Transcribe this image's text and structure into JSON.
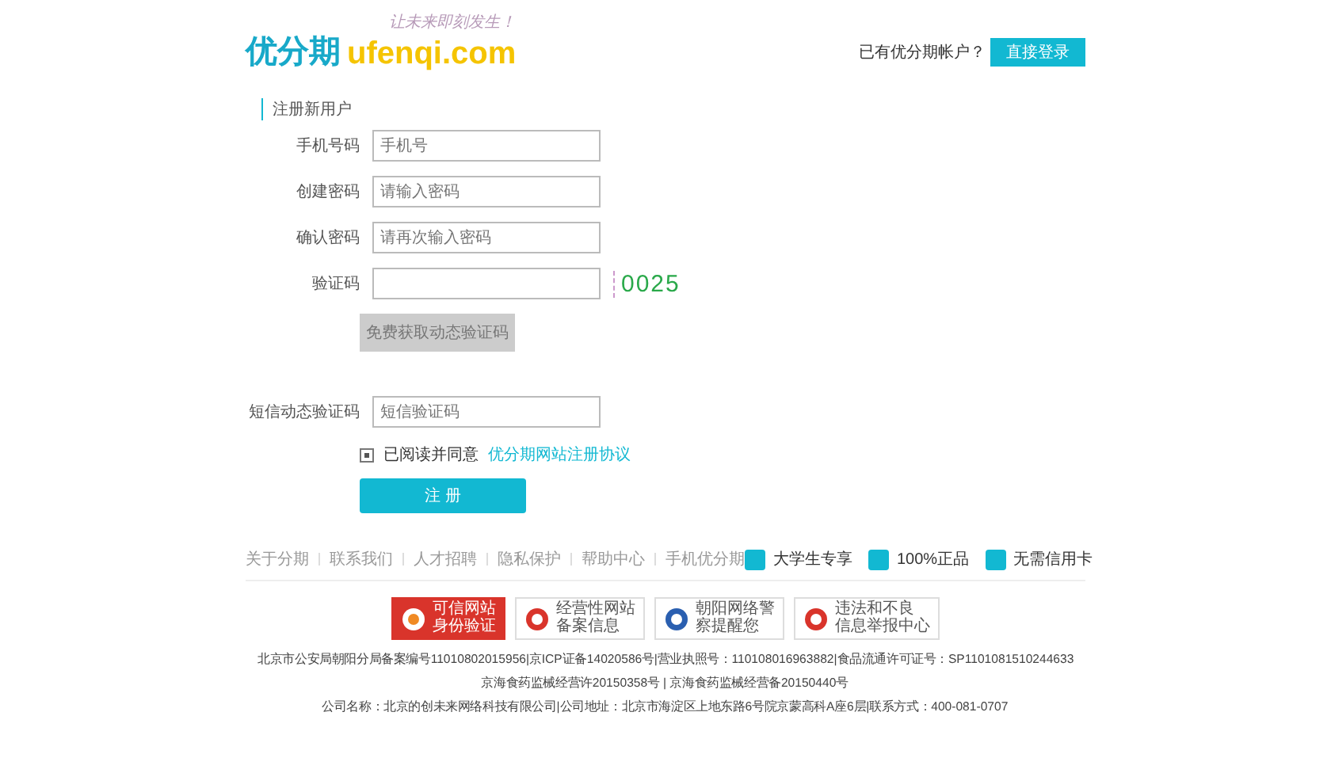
{
  "header": {
    "logo_cn": "优分期",
    "logo_en": "ufenqi.com",
    "slogan": "让未来即刻发生！",
    "account_prompt": "已有优分期帐户？",
    "login_button": "直接登录"
  },
  "form": {
    "title": "注册新用户",
    "fields": [
      {
        "kind": "input",
        "label": "手机号码",
        "placeholder": "手机号"
      },
      {
        "kind": "input",
        "label": "创建密码",
        "placeholder": "请输入密码"
      },
      {
        "kind": "input",
        "label": "确认密码",
        "placeholder": "请再次输入密码"
      },
      {
        "kind": "captcha",
        "label": "验证码",
        "captcha": "0025"
      },
      {
        "kind": "button",
        "label": "免费获取动态验证码",
        "disabled": true
      },
      {
        "kind": "input",
        "label": "短信动态验证码",
        "placeholder": "短信验证码"
      }
    ],
    "agreement": {
      "checked": true,
      "text": "已阅读并同意",
      "link": "优分期网站注册协议"
    },
    "submit": "注 册"
  },
  "footer": {
    "links": [
      "关于分期",
      "联系我们",
      "人才招聘",
      "隐私保护",
      "帮助中心",
      "手机优分期"
    ],
    "features": [
      "大学生专享",
      "100%正品",
      "无需信用卡"
    ],
    "badges": [
      {
        "line1": "可信网站",
        "line2": "身份验证"
      },
      {
        "line1": "经营性网站",
        "line2": "备案信息"
      },
      {
        "line1": "朝阳网络警",
        "line2": "察提醒您"
      },
      {
        "line1": "违法和不良",
        "line2": "信息举报中心"
      }
    ],
    "legal": [
      "北京市公安局朝阳分局备案编号11010802015956|京ICP证备14020586号|营业执照号：110108016963882|食品流通许可证号：SP1101081510244633",
      "京海食药监械经营许20150358号 | 京海食药监械经营备20150440号",
      "公司名称：北京的创未来网络科技有限公司|公司地址：北京市海淀区上地东路6号院京蒙高科A座6层|联系方式：400-081-0707"
    ]
  }
}
